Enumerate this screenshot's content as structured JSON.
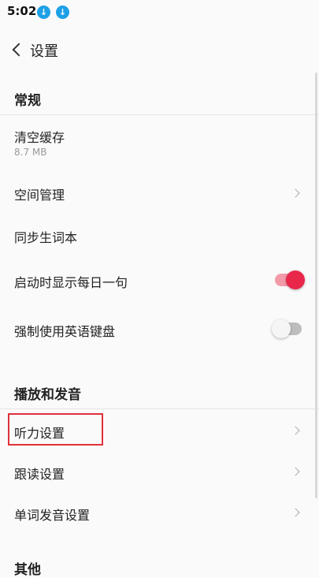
{
  "status_bar": {
    "time": "5:02",
    "icons": [
      "download-icon",
      "download-icon"
    ]
  },
  "header": {
    "title": "设置",
    "back_icon": "chevron-left-icon"
  },
  "sections": {
    "general": "常规",
    "playback": "播放和发音",
    "other_partial": "其他"
  },
  "general": {
    "clear_cache": {
      "label": "清空缓存",
      "value": "8.7 MB"
    },
    "space": {
      "label": "空间管理"
    },
    "sync": {
      "label": "同步生词本"
    },
    "daily": {
      "label": "启动时显示每日一句",
      "enabled": true
    },
    "force_english": {
      "label": "强制使用英语键盘",
      "enabled": false
    }
  },
  "playback": {
    "listening": {
      "label": "听力设置"
    },
    "follow": {
      "label": "跟读设置"
    },
    "word_pron": {
      "label": "单词发音设置"
    }
  },
  "colors": {
    "accent": "#e8274b",
    "highlight_border": "#e0313a",
    "download_badge": "#1ea0e6"
  }
}
